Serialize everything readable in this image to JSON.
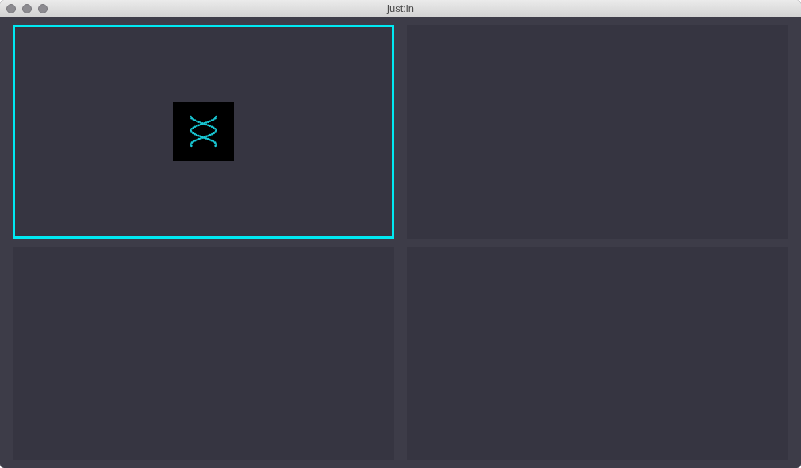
{
  "window": {
    "title": "just:in"
  },
  "panels": [
    {
      "selected": true,
      "loading": true
    },
    {
      "selected": false,
      "loading": false
    },
    {
      "selected": false,
      "loading": false
    },
    {
      "selected": false,
      "loading": false
    }
  ]
}
